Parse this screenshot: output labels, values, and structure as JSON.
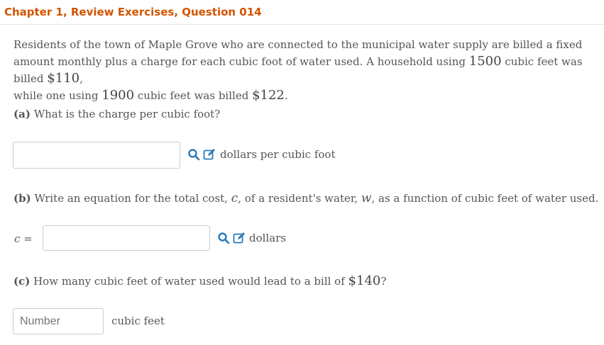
{
  "header": {
    "title": "Chapter 1, Review Exercises, Question 014"
  },
  "problem": {
    "text1": "Residents of the town of Maple Grove who are connected to the municipal water supply are billed a fixed amount monthly plus a charge for each cubic foot of water used. A household using ",
    "n1": "1500",
    "text2": " cubic feet was billed ",
    "n2": "$110",
    "text3": ",",
    "text4": "while one using ",
    "n3": "1900",
    "text5": " cubic feet was billed ",
    "n4": "$122",
    "text6": "."
  },
  "part_a": {
    "label": "(a)",
    "question": " What is the charge per cubic foot?",
    "input_value": "",
    "unit": "dollars per cubic foot"
  },
  "part_b": {
    "label": "(b)",
    "q1": " Write an equation for the total cost, ",
    "var_c": "c",
    "q2": ", of a resident's water, ",
    "var_w": "w",
    "q3": ", as a function of cubic feet of water used.",
    "eq_label": "c =",
    "input_value": "",
    "unit": "dollars"
  },
  "part_c": {
    "label": "(c)",
    "q1": " How many cubic feet of water used would lead to a bill of ",
    "amount": "$140",
    "q2": "?",
    "input_placeholder": "Number",
    "unit": "cubic feet"
  },
  "icons": {
    "search": "search-icon",
    "edit": "edit-icon"
  },
  "colors": {
    "header": "#d35400",
    "icon": "#2a7ab8"
  }
}
